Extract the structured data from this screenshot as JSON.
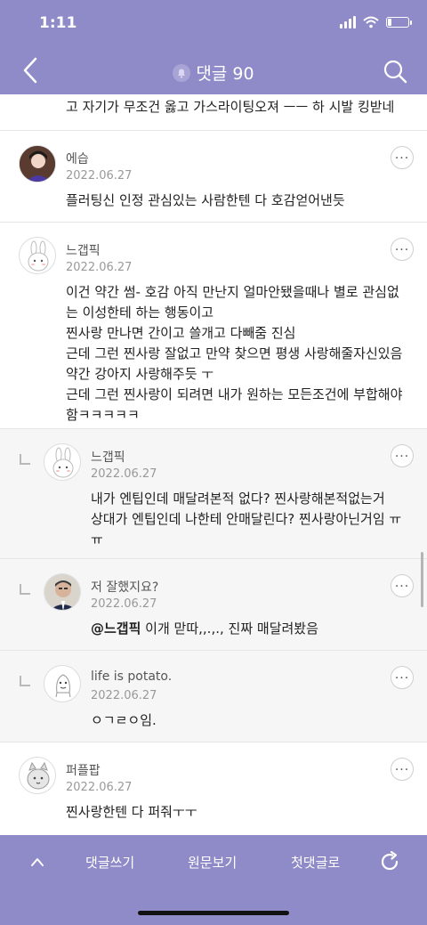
{
  "status": {
    "time": "1:11",
    "battery_level": 0.2
  },
  "nav": {
    "title": "댓글 90",
    "back_icon": "chevron-left-icon",
    "search_icon": "search-icon",
    "bell_icon": "bell-icon"
  },
  "comments": [
    {
      "text": "고 자기가 무조건 옳고 가스라이팅오져 ㅡㅡ 하 시발 킹받네"
    },
    {
      "name": "에습",
      "date": "2022.06.27",
      "text": [
        "플러팅신 인정 관심있는 사람한텐 다 호감얻어낸듯"
      ]
    },
    {
      "name": "느갭픽",
      "date": "2022.06.27",
      "text": [
        "이건 약간 썸- 호감 아직 만난지 얼마안됐을때나 별로 관심없",
        "는 이성한테 하는 행동이고",
        "찐사랑 만나면 간이고 쓸개고 다빼줌 진심",
        "근데 그런 찐사랑 잘없고 만약 찾으면 평생 사랑해줄자신있음",
        "약간 강아지 사랑해주듯 ㅜ",
        "근데 그런 찐사랑이 되려면 내가 원하는 모든조건에 부합해야",
        "함ㅋㅋㅋㅋㅋ"
      ]
    },
    {
      "name": "느갭픽",
      "date": "2022.06.27",
      "text": [
        "내가 엔팁인데 매달려본적 없다? 찐사랑해본적없는거",
        "상대가 엔팁인데 나한테 안매달린다? 찐사랑아닌거임 ㅠ",
        "ㅠ"
      ]
    },
    {
      "name": "저 잘했지요?",
      "date": "2022.06.27",
      "mention": "@느갭픽",
      "text": " 이개 맏따,,.,., 진짜 매달려봤음"
    },
    {
      "name": "life is potato.",
      "date": "2022.06.27",
      "text": [
        "ㅇㄱㄹㅇ임."
      ]
    },
    {
      "name": "퍼플팝",
      "date": "2022.06.27",
      "text": [
        "찐사랑한텐 다 퍼줘ㅜㅜ"
      ]
    }
  ],
  "bottom": {
    "write": "댓글쓰기",
    "original": "원문보기",
    "first": "첫댓글로",
    "up_icon": "chevron-up-icon",
    "refresh_icon": "refresh-icon"
  },
  "colors": {
    "accent": "#8f8bc9"
  }
}
